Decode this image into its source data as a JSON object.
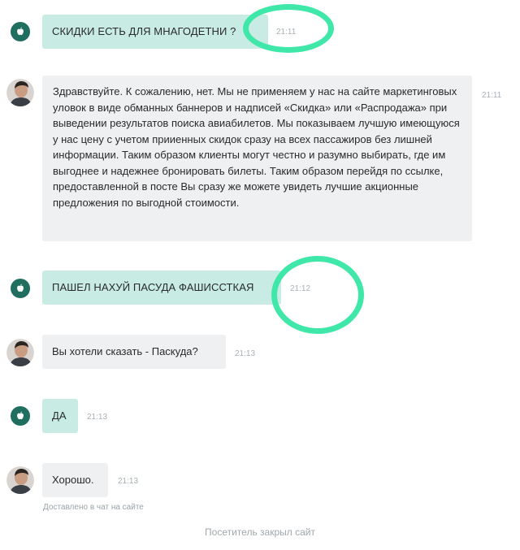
{
  "messages": [
    {
      "sender": "visitor",
      "text": "СКИДКИ ЕСТЬ ДЛЯ МНАГОДЕТНИ ?",
      "time": "21:11"
    },
    {
      "sender": "operator",
      "text": "Здравствуйте. К сожалению, нет. Мы не применяем у нас на сайте маркетинговых уловок в виде обманных баннеров и надписей «Скидка» или «Распродажа» при выведении результатов поиска авиабилетов. Мы показываем лучшую имеющуюся у нас цену с учетом прииенных скидок сразу на всех пассажиров без лишней информации. Таким образом клиенты могут честно и разумно выбирать, где им выгоднее и надежнее бронировать билеты. Таким образом перейдя по ссылке, предоставленной в посте Вы сразу же можете увидеть лучшие акционные предложения по выгодной стоимости.",
      "time": "21:11"
    },
    {
      "sender": "visitor",
      "text": "ПАШЕЛ НАХУЙ ПАСУДА ФАШИССТКАЯ",
      "time": "21:12"
    },
    {
      "sender": "operator",
      "text": "Вы хотели сказать - Паскуда?",
      "time": "21:13"
    },
    {
      "sender": "visitor",
      "text": "ДА",
      "time": "21:13"
    },
    {
      "sender": "operator",
      "text": "Хорошо.",
      "time": "21:13"
    }
  ],
  "delivered_note": "Доставлено в чат на сайте",
  "closed_status": "Посетитель закрыл сайт",
  "icons": {
    "visitor_avatar": "apple-icon",
    "operator_avatar": "operator-photo"
  },
  "colors": {
    "visitor_bubble": "#c8ebe4",
    "operator_bubble": "#eef0f2",
    "visitor_avatar": "#1f6e60",
    "highlight_circle": "#3fe8a9",
    "timestamp": "#a7b1b6"
  }
}
